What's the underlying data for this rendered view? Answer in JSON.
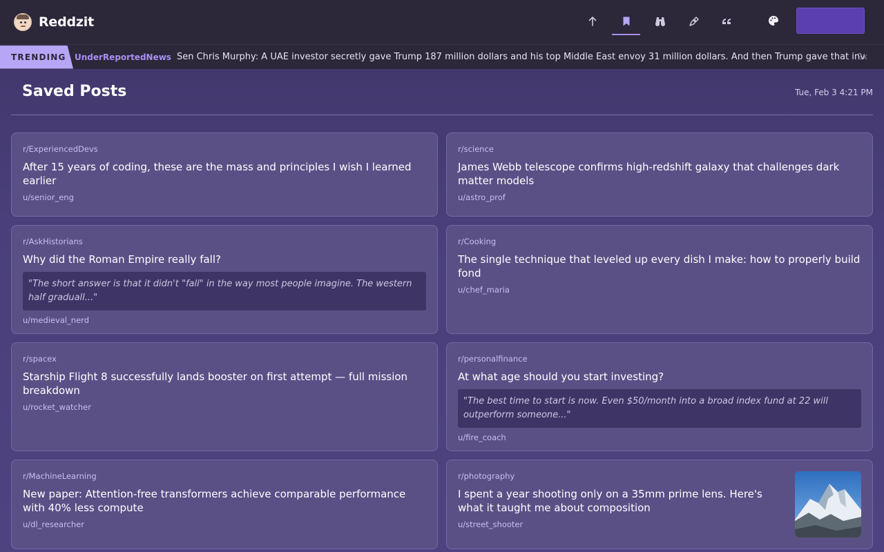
{
  "header": {
    "brand": "Reddzit",
    "nav": [
      {
        "icon": "arrow-up-icon",
        "active": false
      },
      {
        "icon": "bookmark-icon",
        "active": true
      },
      {
        "icon": "binoculars-icon",
        "active": false
      },
      {
        "icon": "pen-icon",
        "active": false
      },
      {
        "icon": "quote-icon",
        "active": false
      }
    ],
    "palette_icon": "palette-icon",
    "accent": "#5b3fb0"
  },
  "trending": {
    "label": "TRENDING",
    "subreddit": "UnderReportedNews",
    "text": "Sen Chris Murphy: A UAE investor secretly gave Trump 187 million dollars and his top Middle East envoy 31 million dollars. And then Trump gave that investor access to",
    "speed": "2x"
  },
  "page": {
    "title": "Saved Posts",
    "datetime": "Tue, Feb 3 4:21 PM"
  },
  "posts": [
    {
      "subreddit": "r/ExperiencedDevs",
      "title": "After 15 years of coding, these are the mass and principles I wish I learned earlier",
      "author": "u/senior_eng"
    },
    {
      "subreddit": "r/science",
      "title": "James Webb telescope confirms high-redshift galaxy that challenges dark matter models",
      "author": "u/astro_prof"
    },
    {
      "subreddit": "r/AskHistorians",
      "title": "Why did the Roman Empire really fall?",
      "quote": "\"The short answer is that it didn't \"fall\" in the way most people imagine. The western half graduall...\"",
      "author": "u/medieval_nerd"
    },
    {
      "subreddit": "r/Cooking",
      "title": "The single technique that leveled up every dish I make: how to properly build fond",
      "author": "u/chef_maria"
    },
    {
      "subreddit": "r/spacex",
      "title": "Starship Flight 8 successfully lands booster on first attempt — full mission breakdown",
      "author": "u/rocket_watcher"
    },
    {
      "subreddit": "r/personalfinance",
      "title": "At what age should you start investing?",
      "quote": "\"The best time to start is now. Even $50/month into a broad index fund at 22 will outperform someone...\"",
      "author": "u/fire_coach"
    },
    {
      "subreddit": "r/MachineLearning",
      "title": "New paper: Attention-free transformers achieve comparable performance with 40% less compute",
      "author": "u/dl_researcher"
    },
    {
      "subreddit": "r/photography",
      "title": "I spent a year shooting only on a 35mm prime lens. Here's what it taught me about composition",
      "author": "u/street_shooter",
      "thumbnail": "mountain-photo"
    }
  ]
}
